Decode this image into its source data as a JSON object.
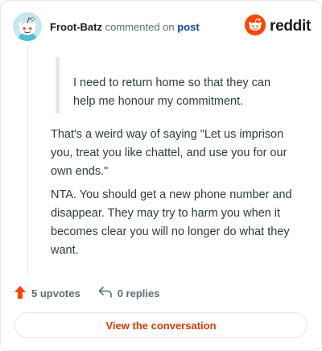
{
  "header": {
    "username": "Froot-Batz",
    "action_text": "commented on",
    "post_link": "post",
    "logo_text": "reddit",
    "avatar_icon": "snoo-avatar-icon",
    "logo_icon": "reddit-alien-icon",
    "brand_color": "#ff4500"
  },
  "comment": {
    "quote": "I need to return home so that they can help me honour my commitment.",
    "paragraphs": [
      "That's a weird way of saying \"Let us imprison you, treat you like chattel, and use you for our own ends.\"",
      "NTA. You should get a new phone number and disappear. They may try to harm you when it becomes clear you will no longer do what they want."
    ]
  },
  "actions": {
    "upvotes": "5 upvotes",
    "replies": "0 replies",
    "upvote_icon": "upvote-arrow-icon",
    "reply_icon": "reply-arrow-icon"
  },
  "footer": {
    "button_label": "View the conversation"
  }
}
